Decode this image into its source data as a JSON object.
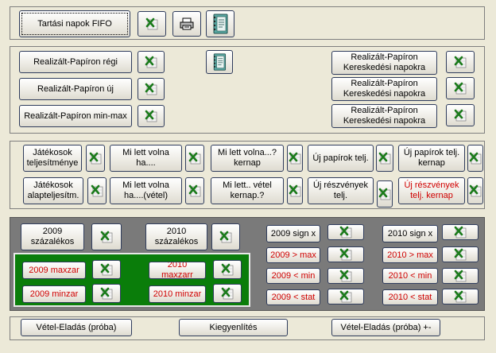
{
  "top": {
    "fifo_label": "Tartási napok FIFO"
  },
  "section2": {
    "left_buttons": [
      "Realizált-Papíron régi",
      "Realizált-Papíron új",
      "Realizált-Papíron min-max"
    ],
    "right_buttons": [
      "Realizált-Papíron\nKereskedési napokra",
      "Realizált-Papíron\nKereskedési napokra",
      "Realizált-Papíron\nKereskedési napokra"
    ]
  },
  "section3": {
    "row1": [
      "Játékosok\nteljesítménye",
      "Mi lett volna ha....",
      "Mi lett volna...?\nkernap",
      "Új papírok telj.",
      "Új papírok telj.\nkernap"
    ],
    "row2": [
      "Játékosok\nalapteljesítm.",
      "Mi lett volna\nha....(vétel)",
      "Mi lett.. vétel\nkernap.?",
      "Új részvények\ntelj.",
      "Új részvények\ntelj. kernap"
    ]
  },
  "section4": {
    "pct_2009": "2009\nszázalékos",
    "pct_2010": "2010\nszázalékos",
    "maxzar_2009": "2009  maxzar",
    "minzar_2009": "2009  minzar",
    "maxzarr_2010": "2010 maxzarr",
    "minzar_2010": "2010 minzar",
    "col_2009": [
      "2009  sign x",
      "2009  > max",
      "2009  < min",
      "2009  < stat"
    ],
    "col_2010": [
      "2010 sign x",
      "2010  > max",
      "2010  < min",
      "2010  < stat"
    ]
  },
  "bottom": {
    "vetel_elado_proba": "Vétel-Eladás (próba)",
    "kiegyenlites": "Kiegyenlítés",
    "vetel_elado_proba_pm": "Vétel-Eladás (próba) +-"
  },
  "icons": {
    "excel": "excel-icon",
    "printer": "printer-icon",
    "notebook": "notebook-icon"
  },
  "colors": {
    "red_text": "#d00000",
    "green_panel": "#0a7d0a",
    "gray_panel": "#7a7a7a"
  }
}
